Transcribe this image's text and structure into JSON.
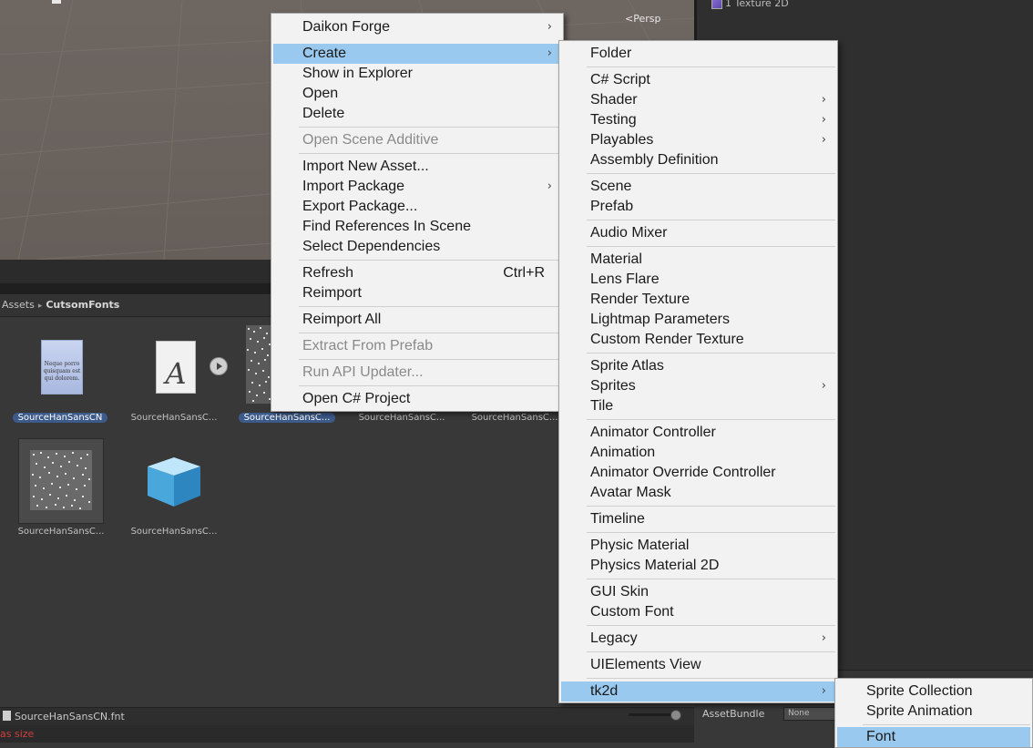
{
  "scene": {
    "persp_label": "<Persp"
  },
  "right_panel": {
    "item": "1 Texture 2D"
  },
  "breadcrumb": {
    "root": "Assets",
    "folder": "CutsomFonts"
  },
  "assets": [
    {
      "label": "SourceHanSansCN",
      "selected": true,
      "doc_text": "Neque porro quisquam est qui dolorem."
    },
    {
      "label": "SourceHanSansC...",
      "selected": false,
      "glyph": "A"
    },
    {
      "label": "SourceHanSansC...",
      "selected": true
    },
    {
      "label": "SourceHanSansC...",
      "selected": false
    },
    {
      "label": "SourceHanSansC...",
      "selected": false
    },
    {
      "label": "SourceHanSansC...",
      "selected": false
    },
    {
      "label": "SourceHanSansC...",
      "selected": false
    }
  ],
  "status": {
    "file": "SourceHanSansCN.fnt",
    "assetbundle_label": "AssetBundle",
    "assetbundle_value": "None"
  },
  "console": {
    "message": "as size"
  },
  "context_menu": {
    "items": [
      {
        "label": "Daikon Forge",
        "submenu": true
      },
      {
        "label": "Create",
        "submenu": true,
        "highlighted": true
      },
      {
        "label": "Show in Explorer"
      },
      {
        "label": "Open"
      },
      {
        "label": "Delete"
      },
      {
        "label": "Open Scene Additive",
        "disabled": true
      },
      {
        "label": "Import New Asset..."
      },
      {
        "label": "Import Package",
        "submenu": true
      },
      {
        "label": "Export Package..."
      },
      {
        "label": "Find References In Scene"
      },
      {
        "label": "Select Dependencies"
      },
      {
        "label": "Refresh",
        "shortcut": "Ctrl+R"
      },
      {
        "label": "Reimport"
      },
      {
        "label": "Reimport All"
      },
      {
        "label": "Extract From Prefab",
        "disabled": true
      },
      {
        "label": "Run API Updater...",
        "disabled": true
      },
      {
        "label": "Open C# Project"
      }
    ]
  },
  "create_menu": {
    "items": [
      {
        "label": "Folder"
      },
      {
        "label": "C# Script"
      },
      {
        "label": "Shader",
        "submenu": true
      },
      {
        "label": "Testing",
        "submenu": true
      },
      {
        "label": "Playables",
        "submenu": true
      },
      {
        "label": "Assembly Definition"
      },
      {
        "label": "Scene"
      },
      {
        "label": "Prefab"
      },
      {
        "label": "Audio Mixer"
      },
      {
        "label": "Material"
      },
      {
        "label": "Lens Flare"
      },
      {
        "label": "Render Texture"
      },
      {
        "label": "Lightmap Parameters"
      },
      {
        "label": "Custom Render Texture"
      },
      {
        "label": "Sprite Atlas"
      },
      {
        "label": "Sprites",
        "submenu": true
      },
      {
        "label": "Tile"
      },
      {
        "label": "Animator Controller"
      },
      {
        "label": "Animation"
      },
      {
        "label": "Animator Override Controller"
      },
      {
        "label": "Avatar Mask"
      },
      {
        "label": "Timeline"
      },
      {
        "label": "Physic Material"
      },
      {
        "label": "Physics Material 2D"
      },
      {
        "label": "GUI Skin"
      },
      {
        "label": "Custom Font"
      },
      {
        "label": "Legacy",
        "submenu": true
      },
      {
        "label": "UIElements View"
      },
      {
        "label": "tk2d",
        "submenu": true,
        "highlighted": true
      }
    ]
  },
  "tk2d_menu": {
    "items": [
      {
        "label": "Sprite Collection"
      },
      {
        "label": "Sprite Animation"
      },
      {
        "label": "Font",
        "highlighted": true
      }
    ]
  },
  "icons": {
    "submenu_arrow": "›"
  },
  "colors": {
    "highlight": "#99c9ef",
    "menu_bg": "#f2f2f2",
    "selected_label": "#3c5a8a"
  }
}
